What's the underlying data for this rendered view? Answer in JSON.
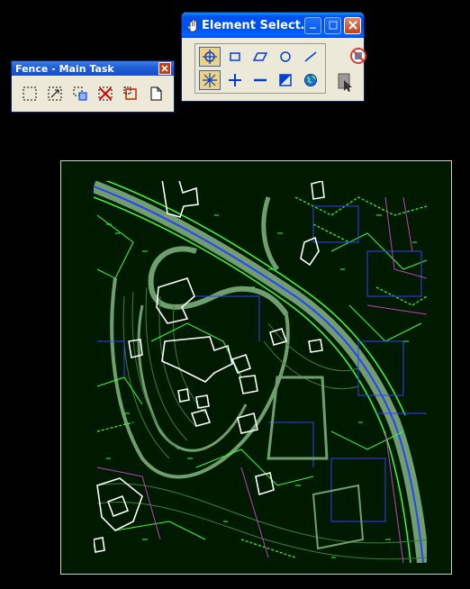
{
  "fence_toolbox": {
    "title": "Fence - Main Task",
    "tools": [
      {
        "name": "place-fence-icon"
      },
      {
        "name": "modify-fence-icon"
      },
      {
        "name": "manipulate-fence-icon"
      },
      {
        "name": "delete-fence-icon"
      },
      {
        "name": "drop-fence-icon"
      },
      {
        "name": "file-fence-icon"
      }
    ]
  },
  "element_selection": {
    "title": "Element Select…",
    "row1": [
      {
        "name": "select-element-icon",
        "selected": true
      },
      {
        "name": "rectangle-mode-icon",
        "selected": false
      },
      {
        "name": "shape-mode-icon",
        "selected": false
      },
      {
        "name": "circle-mode-icon",
        "selected": false
      },
      {
        "name": "line-mode-icon",
        "selected": false
      }
    ],
    "row2": [
      {
        "name": "new-selection-icon",
        "selected": true
      },
      {
        "name": "add-to-selection-icon",
        "selected": false
      },
      {
        "name": "subtract-from-selection-icon",
        "selected": false
      },
      {
        "name": "invert-selection-icon",
        "selected": false
      },
      {
        "name": "select-all-icon",
        "selected": false
      }
    ],
    "right_tools": [
      {
        "name": "clear-selection-icon"
      },
      {
        "name": "pointer-icon"
      }
    ]
  },
  "colors": {
    "map_background": "#001a00",
    "linework_green": "#38ff38",
    "linework_gray": "#6f9f6f",
    "linework_blue": "#3040ff",
    "linework_magenta": "#c040c0",
    "buildings": "#ffffff"
  }
}
